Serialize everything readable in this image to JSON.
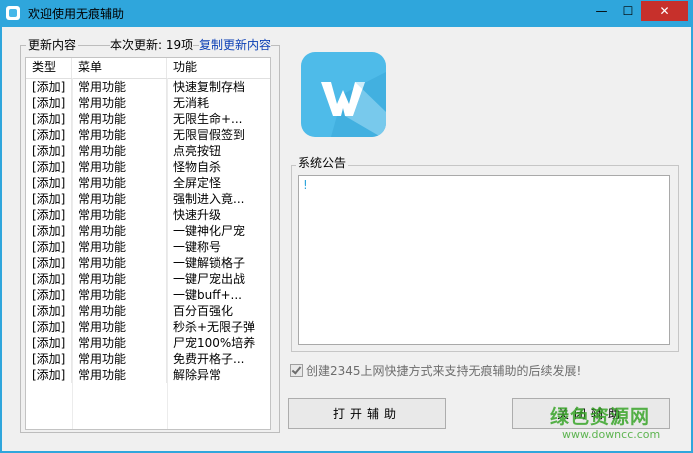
{
  "window": {
    "title": "欢迎使用无痕辅助",
    "minimize": "—",
    "maximize": "☐",
    "close": "✕"
  },
  "updates": {
    "group_title": "更新内容",
    "count_text": "本次更新: 19项",
    "copy_link": "复制更新内容",
    "columns": [
      "类型",
      "菜单",
      "功能"
    ],
    "rows": [
      [
        "[添加]",
        "常用功能",
        "快速复制存档"
      ],
      [
        "[添加]",
        "常用功能",
        "无消耗"
      ],
      [
        "[添加]",
        "常用功能",
        "无限生命+..."
      ],
      [
        "[添加]",
        "常用功能",
        "无限冒假签到"
      ],
      [
        "[添加]",
        "常用功能",
        "点亮按钮"
      ],
      [
        "[添加]",
        "常用功能",
        "怪物自杀"
      ],
      [
        "[添加]",
        "常用功能",
        "全屏定怪"
      ],
      [
        "[添加]",
        "常用功能",
        "强制进入竟..."
      ],
      [
        "[添加]",
        "常用功能",
        "快速升级"
      ],
      [
        "[添加]",
        "常用功能",
        "一键神化尸宠"
      ],
      [
        "[添加]",
        "常用功能",
        "一键称号"
      ],
      [
        "[添加]",
        "常用功能",
        "一键解锁格子"
      ],
      [
        "[添加]",
        "常用功能",
        "一键尸宠出战"
      ],
      [
        "[添加]",
        "常用功能",
        "一键buff+..."
      ],
      [
        "[添加]",
        "常用功能",
        "百分百强化"
      ],
      [
        "[添加]",
        "常用功能",
        "秒杀+无限子弹"
      ],
      [
        "[添加]",
        "常用功能",
        "尸宠100%培养"
      ],
      [
        "[添加]",
        "常用功能",
        "免费开格子..."
      ],
      [
        "[添加]",
        "常用功能",
        "解除异常"
      ]
    ]
  },
  "notice": {
    "title": "系统公告",
    "content": "!"
  },
  "checkbox": {
    "label": "创建2345上网快捷方式来支持无痕辅助的后续发展!",
    "checked": true
  },
  "buttons": {
    "open": "打开辅助",
    "close": "关闭辅助"
  },
  "watermark": {
    "main": "绿色资源网",
    "sub": "www.downcc.com"
  },
  "colors": {
    "titlebar": "#2fa6dc",
    "close_button": "#c7302b",
    "link": "#0c3fb5",
    "logo": "#4ebbe9"
  }
}
